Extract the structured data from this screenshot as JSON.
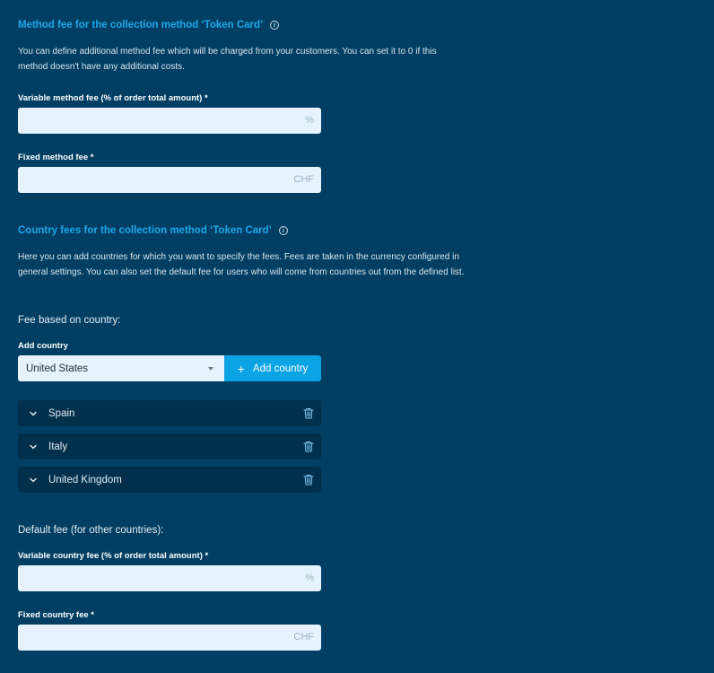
{
  "method_fee": {
    "title": "Method fee for the collection method ‘Token Card’",
    "info_icon": "info-icon",
    "description": "You can define additional method fee which will be charged from your customers. You can set it to 0 if this method doesn't have any additional costs.",
    "variable_label": "Variable method fee (% of order total amount) *",
    "variable_value": "",
    "variable_suffix": "%",
    "fixed_label": "Fixed method fee *",
    "fixed_value": "",
    "fixed_suffix": "CHF"
  },
  "country_fees": {
    "title": "Country fees for the collection method ‘Token Card’",
    "info_icon": "info-icon",
    "description": "Here you can add countries for which you want to specify the fees. Fees are taken in the currency configured in general settings. You can also set the default fee for users who will come from countries out from the defined list.",
    "fee_based_label": "Fee based on country:",
    "add_country_label": "Add country",
    "selected_country": "United States",
    "add_button": {
      "icon": "+",
      "label": "Add country"
    },
    "countries": [
      {
        "name": "Spain",
        "expand_icon": "chevron-down-icon",
        "delete_icon": "trash-icon"
      },
      {
        "name": "Italy",
        "expand_icon": "chevron-down-icon",
        "delete_icon": "trash-icon"
      },
      {
        "name": "United Kingdom",
        "expand_icon": "chevron-down-icon",
        "delete_icon": "trash-icon"
      }
    ]
  },
  "default_fee": {
    "label": "Default fee (for other countries):",
    "variable_label": "Variable country fee (% of order total amount) *",
    "variable_value": "",
    "variable_suffix": "%",
    "fixed_label": "Fixed country fee *",
    "fixed_value": "",
    "fixed_suffix": "CHF"
  },
  "colors": {
    "background": "#003f63",
    "accent": "#1ea7e9",
    "button": "#0aa3e4",
    "input_bg": "#e6f3ff",
    "row_bg": "#01304d"
  }
}
